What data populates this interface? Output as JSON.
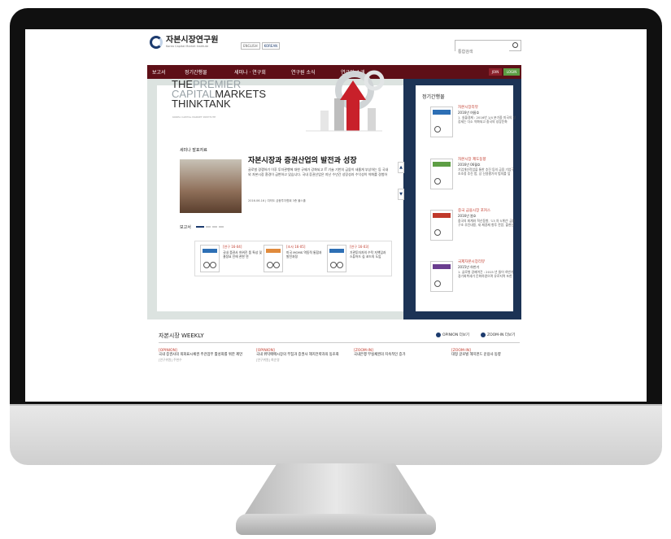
{
  "site": {
    "logo_text": "자본시장연구원",
    "logo_sub": "Korea Capital Market Institute",
    "lang_english": "ENGLISH",
    "lang_korean": "KOREAN",
    "search_placeholder": "통합검색"
  },
  "nav": {
    "items": [
      "보고서",
      "정기간행물",
      "세미나 · 연구회",
      "연구원 소식",
      "연구원 소개"
    ],
    "btn_join": "JOIN",
    "btn_login": "LOGIN"
  },
  "hero": {
    "line1_a": "THE",
    "line1_b": "PREMIER",
    "line2_a": "CAPITAL",
    "line2_b": "MARKETS",
    "line3": "THINKTANK",
    "sub": "KOREA CAPITAL MARKET INSTITUTE"
  },
  "seminar": {
    "section_label": "세미나 발표자료",
    "title": "자본시장과 증권산업의 발전과 성장",
    "desc": "글로벌 경쟁하기 이후 투자관행에 대한 규제가 강화되고 IT 기술 기반의 금융이 새롭게 부상하는 등 국내외 자본시장 환경이 급변하고 있습니다. 국내 증권산업은 지난 수년간 성장성과 수익성이 약화를 경험하",
    "meta": "2016.06.16 | 여의도 금융투자협회 3층 불스홀"
  },
  "reports": {
    "section_label": "보고서",
    "items": [
      {
        "tag": "[연구 16-04]",
        "text": "국내 증권사 허위진 품 특성 및 결정요 인에 관한 연"
      },
      {
        "tag": "[조사 16-05]",
        "text": "미국 MOMS 역동적 통합과 발전과정"
      },
      {
        "tag": "[연구 16-03]",
        "text": "기관투자자의 수탁 자책임과 스튜어드 십 코드의 도입"
      }
    ]
  },
  "periodicals": {
    "title": "정기간행물",
    "items": [
      {
        "head": "자본시장리뷰",
        "date": "2016년 여름호",
        "text": "1. 실물경제 : 2016년 1/4 분기중 미국의 성장세는 다소 약화되고 중국의 성장둔화"
      },
      {
        "head": "자본시장 제도동향",
        "date": "2016년 06월호",
        "text": "기업개선작업을 통한 추진 등의 금융 기업구조조정 추진 법, 상 신용평가의 법의를 앞"
      },
      {
        "head": "중국 금융시장 포커스",
        "date": "2016년 봄호",
        "text": "중국의 회계와 혁신동향, '13 차 5개년' 금융구조 추진내용, 새 제경제 향후 전망, 출현신"
      },
      {
        "head": "국제자본시장리뷰",
        "date": "2015년 하반기",
        "text": "1. 글로벌 경제여건 : 2015 년 들어 하반기 경기회복세가 둔화하였으며 유로지역 또한"
      }
    ]
  },
  "weekly": {
    "title": "자본시장 WEEKLY",
    "btn_opinion": "OPINION 더보기",
    "btn_zoom": "ZOOM-IN 더보기",
    "items": [
      {
        "tag": "[OPINION]",
        "title": "국내 증권사의 외화표시채권 주관업무 활성화를 위한 제언",
        "author": "[연구위원] 주현수"
      },
      {
        "tag": "[OPINION]",
        "title": "국내 위탁매매시장의 부침과 증권사 헤지전략과의 동조화",
        "author": "[연구위원] 최순영"
      },
      {
        "tag": "[ZOOM-IN]",
        "title": "국내은행 부실채권의 지속적인 증가",
        "author": ""
      },
      {
        "tag": "[ZOOM-IN]",
        "title": "대형 글로벌 헤지펀드 운용사 동향",
        "author": ""
      }
    ]
  },
  "colors": {
    "nav_bg": "#5e0f17",
    "brand_blue": "#1c3355",
    "accent_red": "#c0392b"
  }
}
